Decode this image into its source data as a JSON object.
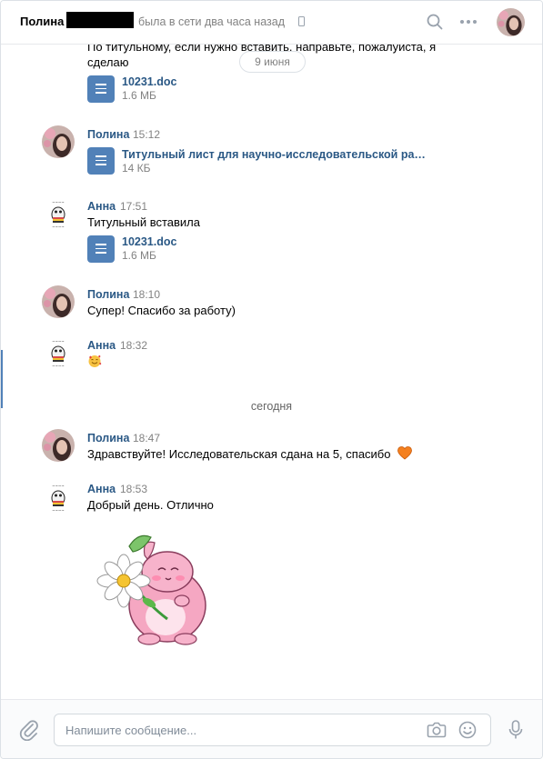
{
  "header": {
    "name": "Полина",
    "status": "была в сети два часа назад"
  },
  "messages": {
    "m0": {
      "text": "По титульному, если нужно вставить. направьте, пожалуйста, я сделаю",
      "date_pill": "9 июня",
      "doc": {
        "name": "10231.doc",
        "size": "1.6 МБ"
      }
    },
    "m1": {
      "author": "Полина",
      "time": "15:12",
      "doc": {
        "name": "Титульный лист для научно-исследовательской ра…",
        "size": "14 КБ"
      }
    },
    "m2": {
      "author": "Анна",
      "time": "17:51",
      "text": "Титульный вставила",
      "doc": {
        "name": "10231.doc",
        "size": "1.6 МБ"
      }
    },
    "m3": {
      "author": "Полина",
      "time": "18:10",
      "text": "Супер! Спасибо за работу)"
    },
    "m4": {
      "author": "Анна",
      "time": "18:32",
      "emoji": "smiling-face-with-hearts"
    },
    "date_separator": "сегодня",
    "m5": {
      "author": "Полина",
      "time": "18:47",
      "text": "Здравствуйте! Исследовательская сдана на 5, спасибо",
      "emoji": "orange-heart"
    },
    "m6": {
      "author": "Анна",
      "time": "18:53",
      "text": "Добрый день. Отлично",
      "sticker": "pink-hamster-with-daisy"
    }
  },
  "composer": {
    "placeholder": "Напишите сообщение..."
  },
  "colors": {
    "link_blue": "#2a5885",
    "accent": "#5181b8",
    "muted": "#828282"
  }
}
